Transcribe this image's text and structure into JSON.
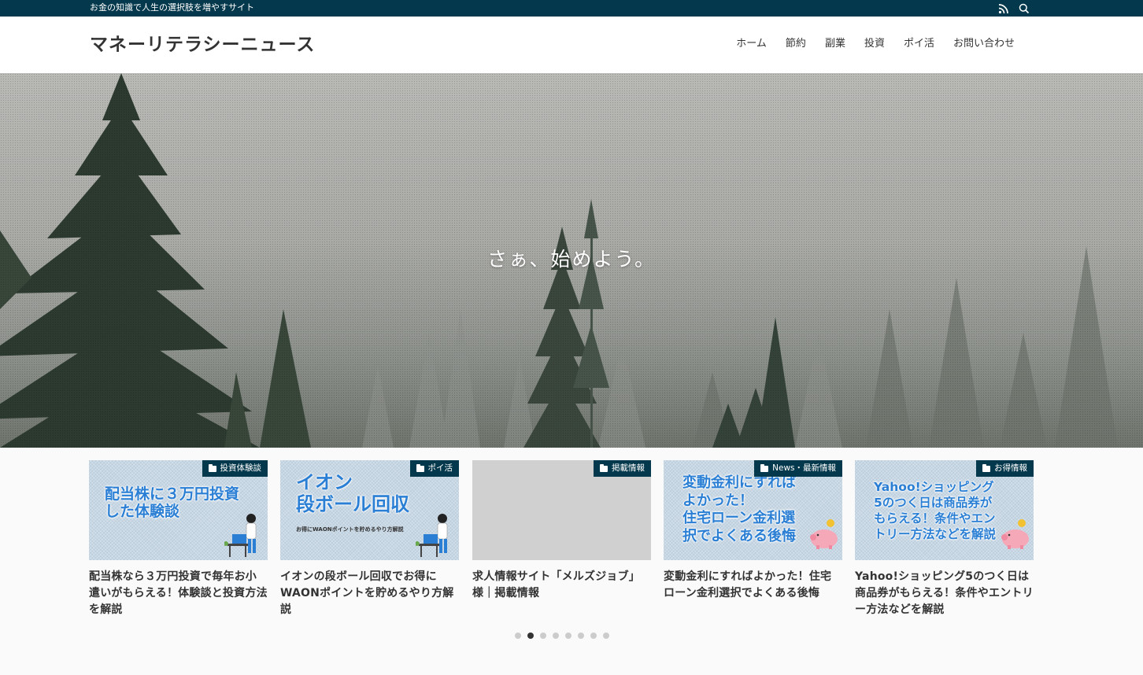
{
  "topbar": {
    "tagline": "お金の知識で人生の選択肢を増やすサイト",
    "icons": [
      "rss-icon",
      "search-icon"
    ],
    "bg_color": "#04384c"
  },
  "header": {
    "site_title": "マネーリテラシーニュース",
    "nav": [
      "ホーム",
      "節約",
      "副業",
      "投資",
      "ポイ活",
      "お問い合わせ"
    ]
  },
  "hero": {
    "catchphrase": "さぁ、始めよう。"
  },
  "cards": [
    {
      "category": "投資体験談",
      "thumb_text": "配当株に３万円投資\nした体験談",
      "title": "配当株なら３万円投資で毎年お小遣いがもらえる！体験談と投資方法を解説"
    },
    {
      "category": "ポイ活",
      "thumb_text": "イオン\n段ボール回収",
      "thumb_sub": "お得にWAONポイントを貯めるやり方解説",
      "title": "イオンの段ボール回収でお得にWAONポイントを貯めるやり方解説"
    },
    {
      "category": "掲載情報",
      "thumb_text": "",
      "title": "求人情報サイト「メルズジョブ」様｜掲載情報"
    },
    {
      "category": "News・最新情報",
      "thumb_text": "変動金利にすれば\nよかった！\n住宅ローン金利選\n択でよくある後悔",
      "title": "変動金利にすればよかった！住宅ローン金利選択でよくある後悔"
    },
    {
      "category": "お得情報",
      "thumb_text": "Yahoo!ショッピング\n5のつく日は商品券が\nもらえる！条件やエン\nトリー方法などを解説",
      "title": "Yahoo!ショッピング5のつく日は商品券がもらえる！条件やエントリー方法などを解説"
    }
  ],
  "pager": {
    "total": 8,
    "active_index": 1
  },
  "colors": {
    "accent": "#04384c",
    "thumb_text": "#2a7fd4"
  }
}
